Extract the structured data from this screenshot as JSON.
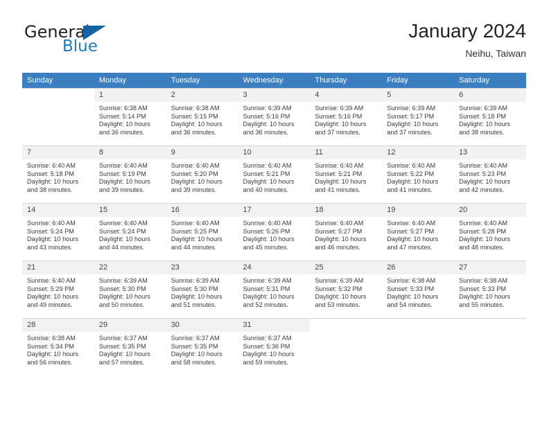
{
  "brand": {
    "name_part1": "General",
    "name_part2": "Blue",
    "triangle_color": "#1464a5",
    "blue_color": "#1f7ac0"
  },
  "header": {
    "title": "January 2024",
    "subtitle": "Neihu, Taiwan"
  },
  "theme": {
    "header_row_bg": "#3c7fc0",
    "header_row_text": "#ffffff",
    "daynum_bg": "#f2f2f2",
    "grid_line": "#d5d5d5"
  },
  "weekdays": [
    "Sunday",
    "Monday",
    "Tuesday",
    "Wednesday",
    "Thursday",
    "Friday",
    "Saturday"
  ],
  "labels": {
    "sunrise_prefix": "Sunrise: ",
    "sunset_prefix": "Sunset: ",
    "daylight_prefix": "Daylight: "
  },
  "weeks": [
    [
      {
        "empty": true
      },
      {
        "day": "1",
        "sunrise": "Sunrise: 6:38 AM",
        "sunset": "Sunset: 5:14 PM",
        "daylight1": "Daylight: 10 hours",
        "daylight2": "and 36 minutes."
      },
      {
        "day": "2",
        "sunrise": "Sunrise: 6:38 AM",
        "sunset": "Sunset: 5:15 PM",
        "daylight1": "Daylight: 10 hours",
        "daylight2": "and 36 minutes."
      },
      {
        "day": "3",
        "sunrise": "Sunrise: 6:39 AM",
        "sunset": "Sunset: 5:16 PM",
        "daylight1": "Daylight: 10 hours",
        "daylight2": "and 36 minutes."
      },
      {
        "day": "4",
        "sunrise": "Sunrise: 6:39 AM",
        "sunset": "Sunset: 5:16 PM",
        "daylight1": "Daylight: 10 hours",
        "daylight2": "and 37 minutes."
      },
      {
        "day": "5",
        "sunrise": "Sunrise: 6:39 AM",
        "sunset": "Sunset: 5:17 PM",
        "daylight1": "Daylight: 10 hours",
        "daylight2": "and 37 minutes."
      },
      {
        "day": "6",
        "sunrise": "Sunrise: 6:39 AM",
        "sunset": "Sunset: 5:18 PM",
        "daylight1": "Daylight: 10 hours",
        "daylight2": "and 38 minutes."
      }
    ],
    [
      {
        "day": "7",
        "sunrise": "Sunrise: 6:40 AM",
        "sunset": "Sunset: 5:18 PM",
        "daylight1": "Daylight: 10 hours",
        "daylight2": "and 38 minutes."
      },
      {
        "day": "8",
        "sunrise": "Sunrise: 6:40 AM",
        "sunset": "Sunset: 5:19 PM",
        "daylight1": "Daylight: 10 hours",
        "daylight2": "and 39 minutes."
      },
      {
        "day": "9",
        "sunrise": "Sunrise: 6:40 AM",
        "sunset": "Sunset: 5:20 PM",
        "daylight1": "Daylight: 10 hours",
        "daylight2": "and 39 minutes."
      },
      {
        "day": "10",
        "sunrise": "Sunrise: 6:40 AM",
        "sunset": "Sunset: 5:21 PM",
        "daylight1": "Daylight: 10 hours",
        "daylight2": "and 40 minutes."
      },
      {
        "day": "11",
        "sunrise": "Sunrise: 6:40 AM",
        "sunset": "Sunset: 5:21 PM",
        "daylight1": "Daylight: 10 hours",
        "daylight2": "and 41 minutes."
      },
      {
        "day": "12",
        "sunrise": "Sunrise: 6:40 AM",
        "sunset": "Sunset: 5:22 PM",
        "daylight1": "Daylight: 10 hours",
        "daylight2": "and 41 minutes."
      },
      {
        "day": "13",
        "sunrise": "Sunrise: 6:40 AM",
        "sunset": "Sunset: 5:23 PM",
        "daylight1": "Daylight: 10 hours",
        "daylight2": "and 42 minutes."
      }
    ],
    [
      {
        "day": "14",
        "sunrise": "Sunrise: 6:40 AM",
        "sunset": "Sunset: 5:24 PM",
        "daylight1": "Daylight: 10 hours",
        "daylight2": "and 43 minutes."
      },
      {
        "day": "15",
        "sunrise": "Sunrise: 6:40 AM",
        "sunset": "Sunset: 5:24 PM",
        "daylight1": "Daylight: 10 hours",
        "daylight2": "and 44 minutes."
      },
      {
        "day": "16",
        "sunrise": "Sunrise: 6:40 AM",
        "sunset": "Sunset: 5:25 PM",
        "daylight1": "Daylight: 10 hours",
        "daylight2": "and 44 minutes."
      },
      {
        "day": "17",
        "sunrise": "Sunrise: 6:40 AM",
        "sunset": "Sunset: 5:26 PM",
        "daylight1": "Daylight: 10 hours",
        "daylight2": "and 45 minutes."
      },
      {
        "day": "18",
        "sunrise": "Sunrise: 6:40 AM",
        "sunset": "Sunset: 5:27 PM",
        "daylight1": "Daylight: 10 hours",
        "daylight2": "and 46 minutes."
      },
      {
        "day": "19",
        "sunrise": "Sunrise: 6:40 AM",
        "sunset": "Sunset: 5:27 PM",
        "daylight1": "Daylight: 10 hours",
        "daylight2": "and 47 minutes."
      },
      {
        "day": "20",
        "sunrise": "Sunrise: 6:40 AM",
        "sunset": "Sunset: 5:28 PM",
        "daylight1": "Daylight: 10 hours",
        "daylight2": "and 48 minutes."
      }
    ],
    [
      {
        "day": "21",
        "sunrise": "Sunrise: 6:40 AM",
        "sunset": "Sunset: 5:29 PM",
        "daylight1": "Daylight: 10 hours",
        "daylight2": "and 49 minutes."
      },
      {
        "day": "22",
        "sunrise": "Sunrise: 6:39 AM",
        "sunset": "Sunset: 5:30 PM",
        "daylight1": "Daylight: 10 hours",
        "daylight2": "and 50 minutes."
      },
      {
        "day": "23",
        "sunrise": "Sunrise: 6:39 AM",
        "sunset": "Sunset: 5:30 PM",
        "daylight1": "Daylight: 10 hours",
        "daylight2": "and 51 minutes."
      },
      {
        "day": "24",
        "sunrise": "Sunrise: 6:39 AM",
        "sunset": "Sunset: 5:31 PM",
        "daylight1": "Daylight: 10 hours",
        "daylight2": "and 52 minutes."
      },
      {
        "day": "25",
        "sunrise": "Sunrise: 6:39 AM",
        "sunset": "Sunset: 5:32 PM",
        "daylight1": "Daylight: 10 hours",
        "daylight2": "and 53 minutes."
      },
      {
        "day": "26",
        "sunrise": "Sunrise: 6:38 AM",
        "sunset": "Sunset: 5:33 PM",
        "daylight1": "Daylight: 10 hours",
        "daylight2": "and 54 minutes."
      },
      {
        "day": "27",
        "sunrise": "Sunrise: 6:38 AM",
        "sunset": "Sunset: 5:33 PM",
        "daylight1": "Daylight: 10 hours",
        "daylight2": "and 55 minutes."
      }
    ],
    [
      {
        "day": "28",
        "sunrise": "Sunrise: 6:38 AM",
        "sunset": "Sunset: 5:34 PM",
        "daylight1": "Daylight: 10 hours",
        "daylight2": "and 56 minutes."
      },
      {
        "day": "29",
        "sunrise": "Sunrise: 6:37 AM",
        "sunset": "Sunset: 5:35 PM",
        "daylight1": "Daylight: 10 hours",
        "daylight2": "and 57 minutes."
      },
      {
        "day": "30",
        "sunrise": "Sunrise: 6:37 AM",
        "sunset": "Sunset: 5:35 PM",
        "daylight1": "Daylight: 10 hours",
        "daylight2": "and 58 minutes."
      },
      {
        "day": "31",
        "sunrise": "Sunrise: 6:37 AM",
        "sunset": "Sunset: 5:36 PM",
        "daylight1": "Daylight: 10 hours",
        "daylight2": "and 59 minutes."
      },
      {
        "empty": true
      },
      {
        "empty": true
      },
      {
        "empty": true
      }
    ]
  ]
}
